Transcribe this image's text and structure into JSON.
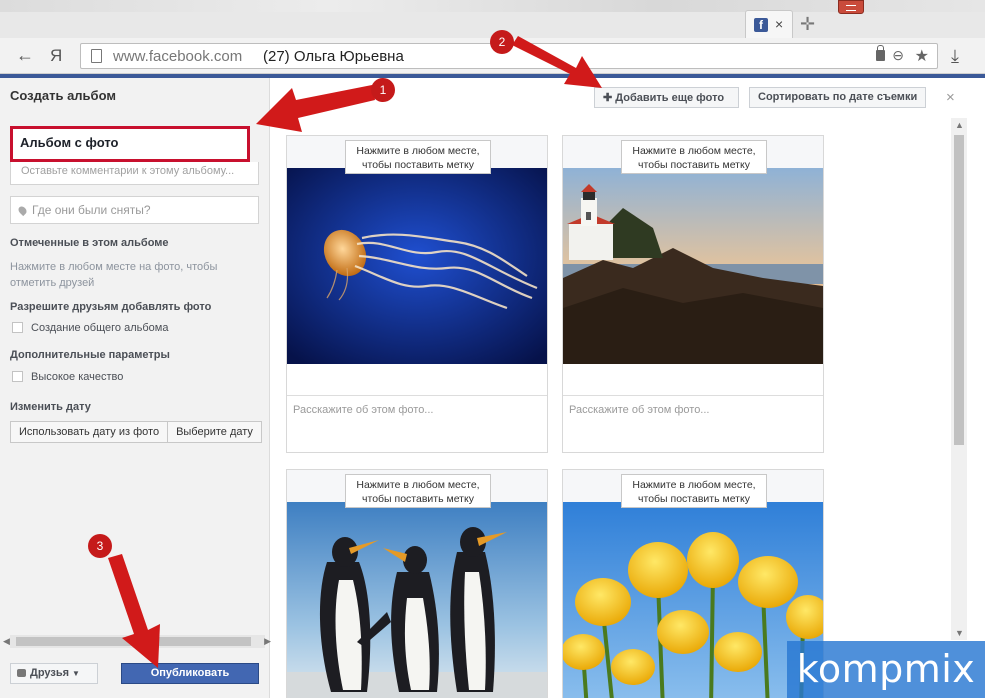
{
  "browser": {
    "url_host": "www.facebook.com",
    "page_title": "(27) Ольга Юрьевна",
    "tab_close": "×",
    "yandex_letter": "Я",
    "favicon_letter": "f"
  },
  "dialog": {
    "title": "Создать альбом",
    "album_name": "Альбом с фото",
    "description_placeholder": "Оставьте комментарии к этому альбому...",
    "location_placeholder": "Где они были сняты?",
    "tagged_label": "Отмеченные в этом альбоме",
    "tagged_hint": "Нажмите в любом месте на фото, чтобы отметить друзей",
    "allow_friends_label": "Разрешите друзьям добавлять фото",
    "shared_album_label": "Создание общего альбома",
    "advanced_label": "Дополнительные параметры",
    "high_quality_label": "Высокое качество",
    "change_date_label": "Изменить дату",
    "use_photo_date": "Использовать дату из фото",
    "choose_date": "Выберите дату",
    "privacy": "Друзья",
    "publish": "Опубликовать",
    "add_photos": "Добавить еще фото",
    "sort_by_date": "Сортировать по дате съемки",
    "close": "×"
  },
  "photos": [
    {
      "tag_hint_line1": "Нажмите в любом месте,",
      "tag_hint_line2": "чтобы поставить метку",
      "caption_placeholder": "Расскажите об этом фото...",
      "subject": "jellyfish"
    },
    {
      "tag_hint_line1": "Нажмите в любом месте,",
      "tag_hint_line2": "чтобы поставить метку",
      "caption_placeholder": "Расскажите об этом фото...",
      "subject": "lighthouse"
    },
    {
      "tag_hint_line1": "Нажмите в любом месте,",
      "tag_hint_line2": "чтобы поставить метку",
      "subject": "penguins"
    },
    {
      "tag_hint_line1": "Нажмите в любом месте,",
      "tag_hint_line2": "чтобы поставить метку",
      "subject": "tulips"
    }
  ],
  "annotations": {
    "marker_1": "1",
    "marker_2": "2",
    "marker_3": "3",
    "color": "#c51a1a"
  },
  "watermark": {
    "text": "kompmix",
    "color": "#2878d2"
  },
  "colors": {
    "facebook_blue": "#3b5998",
    "publish_button": "#4267b2",
    "highlight_border": "#c8102e"
  }
}
